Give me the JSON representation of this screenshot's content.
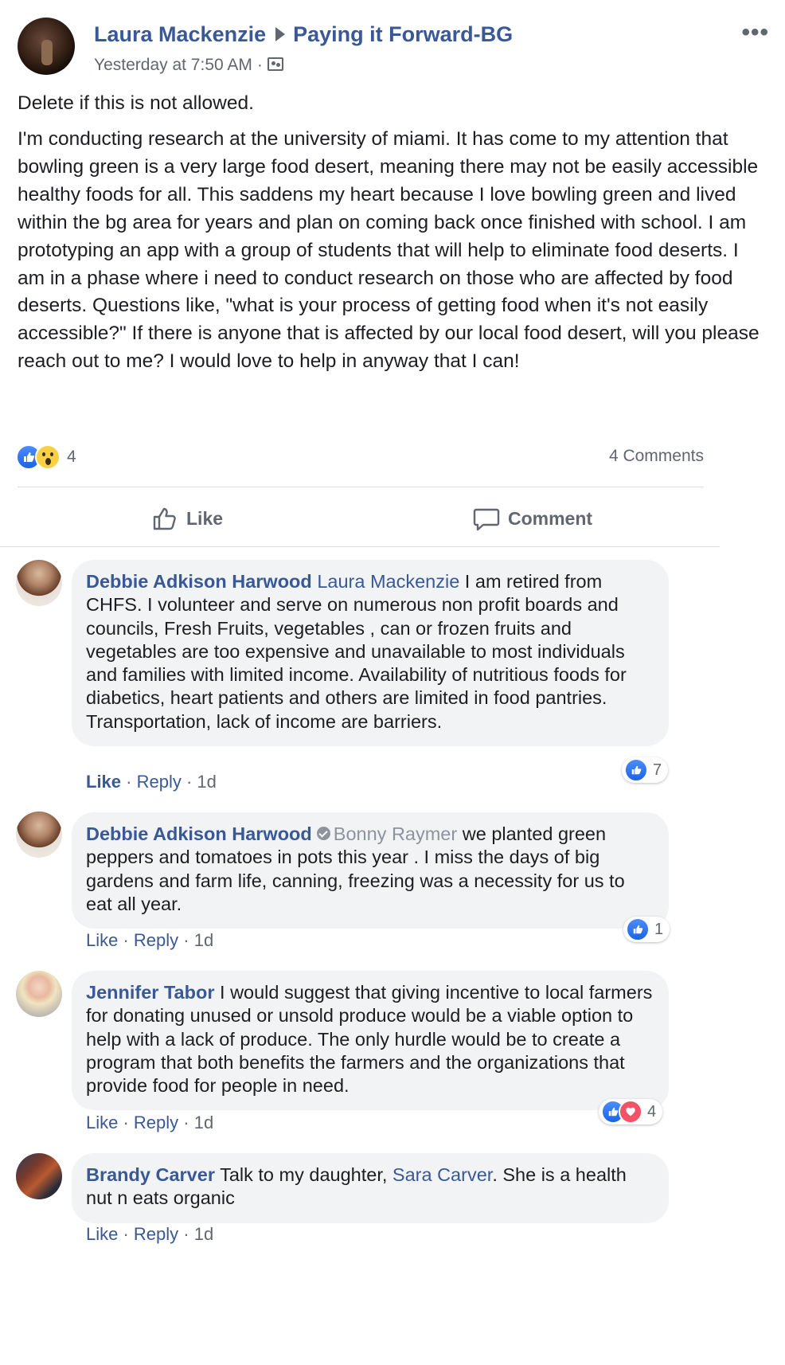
{
  "post": {
    "author": "Laura Mackenzie",
    "group": "Paying it Forward-BG",
    "timestamp": "Yesterday at 7:50 AM",
    "more": "•••",
    "text1": "Delete if this is not allowed.",
    "text2": "I'm conducting research at the university of miami. It has come to my attention that bowling green is a very large food desert, meaning there may not be easily accessible healthy foods for all. This saddens my heart because I love bowling green and lived within the bg area for years and plan on coming back once finished with school. I am prototyping an app with a group of students that will help to eliminate food deserts. I am in a phase where i need to conduct research on those who are affected by food deserts. Questions like, \"what is your process of getting food when it's not easily accessible?\" If there is anyone that is affected by our local food desert, will you please reach out to me? I would love to help in anyway that I can!",
    "reaction_count": "4",
    "comments_count": "4 Comments",
    "like_label": "Like",
    "comment_label": "Comment"
  },
  "comments": [
    {
      "author": "Debbie Adkison Harwood",
      "mention": "Laura Mackenzie",
      "text": " I am retired from CHFS. I volunteer and serve on numerous non profit boards and councils, Fresh Fruits, vegetables , can or frozen fruits and vegetables are too expensive and unavailable to most individuals and families with limited income. Availability of nutritious foods for diabetics, heart patients and others are limited in food pantries. Transportation, lack of income are barriers.",
      "like": "Like",
      "reply": "Reply",
      "time": "1d",
      "reaction_count": "7"
    },
    {
      "author": "Debbie Adkison Harwood",
      "mention": "Bonny Raymer",
      "text": " we planted green peppers and tomatoes in pots this year . I miss the days of big gardens and farm life, canning, freezing was a necessity for us to eat all year.",
      "like": "Like",
      "reply": "Reply",
      "time": "1d",
      "reaction_count": "1"
    },
    {
      "author": "Jennifer Tabor",
      "text": " I would suggest that giving incentive to local farmers for donating unused or unsold produce would be a viable option to help with a lack of produce. The only hurdle would be to create a program that both benefits the farmers and the organizations that provide food for people in need.",
      "like": "Like",
      "reply": "Reply",
      "time": "1d",
      "reaction_count": "4"
    },
    {
      "author": "Brandy Carver",
      "text_before": " Talk to my daughter, ",
      "mention": "Sara Carver",
      "text_after": ". She is a health nut n eats organic",
      "like": "Like",
      "reply": "Reply",
      "time": "1d"
    }
  ],
  "icons": {
    "like": "thumbs-up-icon",
    "comment": "speech-bubble-icon",
    "more": "more-dots-icon",
    "group": "group-icon",
    "reactions": [
      "like-reaction-icon",
      "wow-reaction-icon",
      "love-reaction-icon"
    ]
  },
  "colors": {
    "link": "#385898",
    "secondary_text": "#606770",
    "bubble": "#f2f3f5",
    "like_blue": "#1b63e6",
    "love_red": "#f25268",
    "wow_yellow": "#f7d143"
  }
}
